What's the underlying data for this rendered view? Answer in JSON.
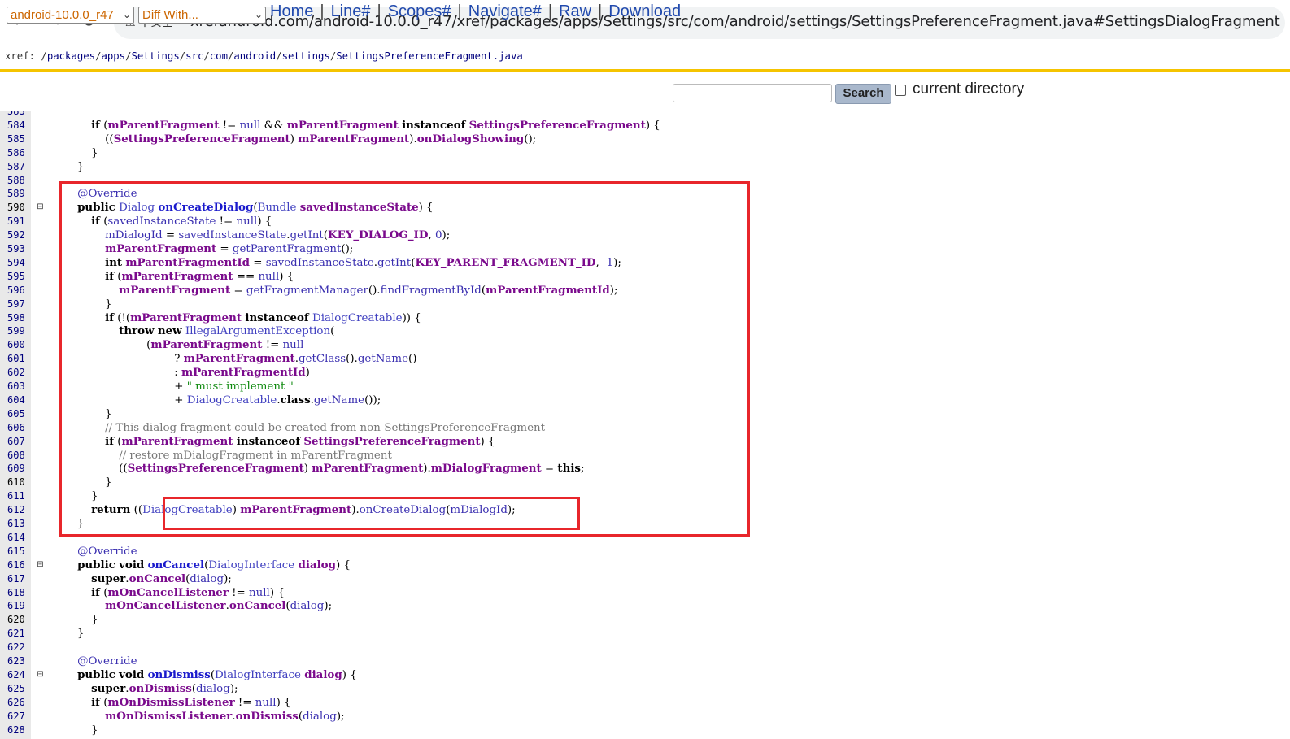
{
  "browser": {
    "security_label": "不安全",
    "url": "xrefandroid.com/android-10.0.0_r47/xref/packages/apps/Settings/src/com/android/settings/SettingsPreferenceFragment.java#SettingsDialogFragment"
  },
  "breadcrumb": {
    "prefix": "xref: /",
    "parts": [
      "packages",
      "apps",
      "Settings",
      "src",
      "com",
      "android",
      "settings",
      "SettingsPreferenceFragment.java"
    ]
  },
  "toolbar": {
    "version_select": "android-10.0.0_r47",
    "diff_select": "Diff With...",
    "links": [
      "Home",
      "Line#",
      "Scopes#",
      "Navigate#",
      "Raw",
      "Download"
    ],
    "search_value": "",
    "search_button": "Search",
    "checkbox_label": "current directory"
  },
  "code": {
    "current_line": 590,
    "folds": [
      590,
      616,
      624
    ],
    "lines": [
      {
        "n": 583,
        "html": ""
      },
      {
        "n": 584,
        "html": "            <span class='k'>if</span> (<span class='f'>mParentFragment</span> != <span class='a'>null</span> &amp;&amp; <span class='f'>mParentFragment</span> <span class='k'>instanceof</span> <span class='p'>SettingsPreferenceFragment</span>) {"
      },
      {
        "n": 585,
        "html": "                ((<span class='p'>SettingsPreferenceFragment</span>) <span class='f'>mParentFragment</span>).<span class='kc'>onDialogShowing</span>();"
      },
      {
        "n": 586,
        "html": "            }"
      },
      {
        "n": 587,
        "html": "        }"
      },
      {
        "n": 588,
        "html": ""
      },
      {
        "n": 589,
        "html": "        <span class='a'>@Override</span>"
      },
      {
        "n": 590,
        "html": "        <span class='k'>public</span> <span class='t'>Dialog</span> <span class='def'>onCreateDialog</span>(<span class='t'>Bundle</span> <span class='p'>savedInstanceState</span>) {"
      },
      {
        "n": 591,
        "html": "            <span class='k'>if</span> (<span class='m'>savedInstanceState</span> != <span class='a'>null</span>) {"
      },
      {
        "n": 592,
        "html": "                <span class='m'>mDialogId</span> = <span class='m'>savedInstanceState</span>.<span class='m'>getInt</span>(<span class='p'>KEY_DIALOG_ID</span>, <span class='n'>0</span>);"
      },
      {
        "n": 593,
        "html": "                <span class='f'>mParentFragment</span> = <span class='m'>getParentFragment</span>();"
      },
      {
        "n": 594,
        "html": "                <span class='k'>int</span> <span class='f'>mParentFragmentId</span> = <span class='m'>savedInstanceState</span>.<span class='m'>getInt</span>(<span class='p'>KEY_PARENT_FRAGMENT_ID</span>, -<span class='n'>1</span>);"
      },
      {
        "n": 595,
        "html": "                <span class='k'>if</span> (<span class='f'>mParentFragment</span> == <span class='a'>null</span>) {"
      },
      {
        "n": 596,
        "html": "                    <span class='f'>mParentFragment</span> = <span class='m'>getFragmentManager</span>().<span class='m'>findFragmentById</span>(<span class='f'>mParentFragmentId</span>);"
      },
      {
        "n": 597,
        "html": "                }"
      },
      {
        "n": 598,
        "html": "                <span class='k'>if</span> (!(<span class='f'>mParentFragment</span> <span class='k'>instanceof</span> <span class='t'>DialogCreatable</span>)) {"
      },
      {
        "n": 599,
        "html": "                    <span class='k'>throw</span> <span class='k'>new</span> <span class='t'>IllegalArgumentException</span>("
      },
      {
        "n": 600,
        "html": "                            (<span class='f'>mParentFragment</span> != <span class='a'>null</span>"
      },
      {
        "n": 601,
        "html": "                                    ? <span class='f'>mParentFragment</span>.<span class='m'>getClass</span>().<span class='m'>getName</span>()"
      },
      {
        "n": 602,
        "html": "                                    : <span class='f'>mParentFragmentId</span>)"
      },
      {
        "n": 603,
        "html": "                                    + <span class='s'>\" must implement \"</span>"
      },
      {
        "n": 604,
        "html": "                                    + <span class='t'>DialogCreatable</span>.<span class='k'>class</span>.<span class='m'>getName</span>());"
      },
      {
        "n": 605,
        "html": "                }"
      },
      {
        "n": 606,
        "html": "                <span class='c'>// This dialog fragment could be created from non-SettingsPreferenceFragment</span>"
      },
      {
        "n": 607,
        "html": "                <span class='k'>if</span> (<span class='f'>mParentFragment</span> <span class='k'>instanceof</span> <span class='p'>SettingsPreferenceFragment</span>) {"
      },
      {
        "n": 608,
        "html": "                    <span class='c'>// restore mDialogFragment in mParentFragment</span>"
      },
      {
        "n": 609,
        "html": "                    ((<span class='p'>SettingsPreferenceFragment</span>) <span class='f'>mParentFragment</span>).<span class='f'>mDialogFragment</span> = <span class='k'>this</span>;"
      },
      {
        "n": 610,
        "html": "                }"
      },
      {
        "n": 611,
        "html": "            }"
      },
      {
        "n": 612,
        "html": "            <span class='k'>return</span> ((<span class='t'>DialogCreatable</span>) <span class='f'>mParentFragment</span>).<span class='m'>onCreateDialog</span>(<span class='m'>mDialogId</span>);"
      },
      {
        "n": 613,
        "html": "        }"
      },
      {
        "n": 614,
        "html": ""
      },
      {
        "n": 615,
        "html": "        <span class='a'>@Override</span>"
      },
      {
        "n": 616,
        "html": "        <span class='k'>public</span> <span class='k'>void</span> <span class='def'>onCancel</span>(<span class='t'>DialogInterface</span> <span class='p'>dialog</span>) {"
      },
      {
        "n": 617,
        "html": "            <span class='k'>super</span>.<span class='kc'>onCancel</span>(<span class='m'>dialog</span>);"
      },
      {
        "n": 618,
        "html": "            <span class='k'>if</span> (<span class='f'>mOnCancelListener</span> != <span class='a'>null</span>) {"
      },
      {
        "n": 619,
        "html": "                <span class='f'>mOnCancelListener</span>.<span class='kc'>onCancel</span>(<span class='m'>dialog</span>);"
      },
      {
        "n": 620,
        "html": "            }"
      },
      {
        "n": 621,
        "html": "        }"
      },
      {
        "n": 622,
        "html": ""
      },
      {
        "n": 623,
        "html": "        <span class='a'>@Override</span>"
      },
      {
        "n": 624,
        "html": "        <span class='k'>public</span> <span class='k'>void</span> <span class='def'>onDismiss</span>(<span class='t'>DialogInterface</span> <span class='p'>dialog</span>) {"
      },
      {
        "n": 625,
        "html": "            <span class='k'>super</span>.<span class='kc'>onDismiss</span>(<span class='m'>dialog</span>);"
      },
      {
        "n": 626,
        "html": "            <span class='k'>if</span> (<span class='f'>mOnDismissListener</span> != <span class='a'>null</span>) {"
      },
      {
        "n": 627,
        "html": "                <span class='f'>mOnDismissListener</span>.<span class='kc'>onDismiss</span>(<span class='m'>dialog</span>);"
      },
      {
        "n": 628,
        "html": "            }"
      }
    ]
  },
  "annotations": {
    "highlight_color": "#e8262b"
  }
}
